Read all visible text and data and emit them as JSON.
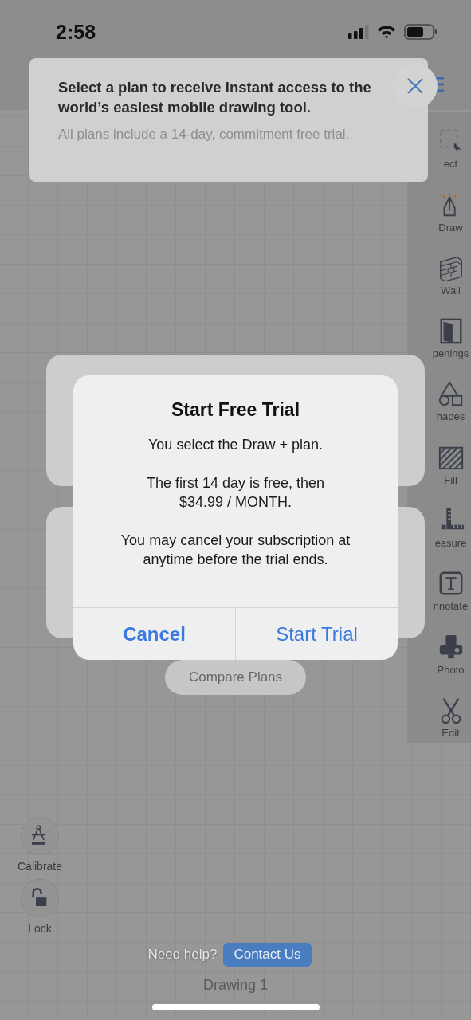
{
  "status_bar": {
    "time": "2:58"
  },
  "banner": {
    "heading": "Select a plan to receive instant access to the world’s easiest mobile drawing tool.",
    "subtext": "All plans include a 14-day, commitment free trial."
  },
  "toolbar": [
    {
      "kind": "select",
      "label": "ect"
    },
    {
      "kind": "draw",
      "label": "Draw"
    },
    {
      "kind": "wall",
      "label": "Wall"
    },
    {
      "kind": "openings",
      "label": "penings"
    },
    {
      "kind": "shapes",
      "label": "hapes"
    },
    {
      "kind": "fill",
      "label": "Fill"
    },
    {
      "kind": "measure",
      "label": "easure"
    },
    {
      "kind": "annotate",
      "label": "nnotate"
    },
    {
      "kind": "photo",
      "label": "Photo"
    },
    {
      "kind": "edit",
      "label": "Edit"
    }
  ],
  "compare_button": "Compare Plans",
  "dialog": {
    "title": "Start Free Trial",
    "messages": [
      "You select the Draw +  plan.",
      "The first 14 day is free, then $34.99 / MONTH.",
      "You may cancel your subscription at anytime before the trial ends."
    ],
    "buttons": [
      {
        "label": "Cancel",
        "emphasized": true
      },
      {
        "label": "Start Trial",
        "emphasized": false
      }
    ]
  },
  "side_tools": [
    {
      "kind": "calibrate",
      "label": "Calibrate"
    },
    {
      "kind": "lock",
      "label": "Lock"
    }
  ],
  "help": {
    "text": "Need help?",
    "button": "Contact Us"
  },
  "drawing_title": "Drawing 1"
}
